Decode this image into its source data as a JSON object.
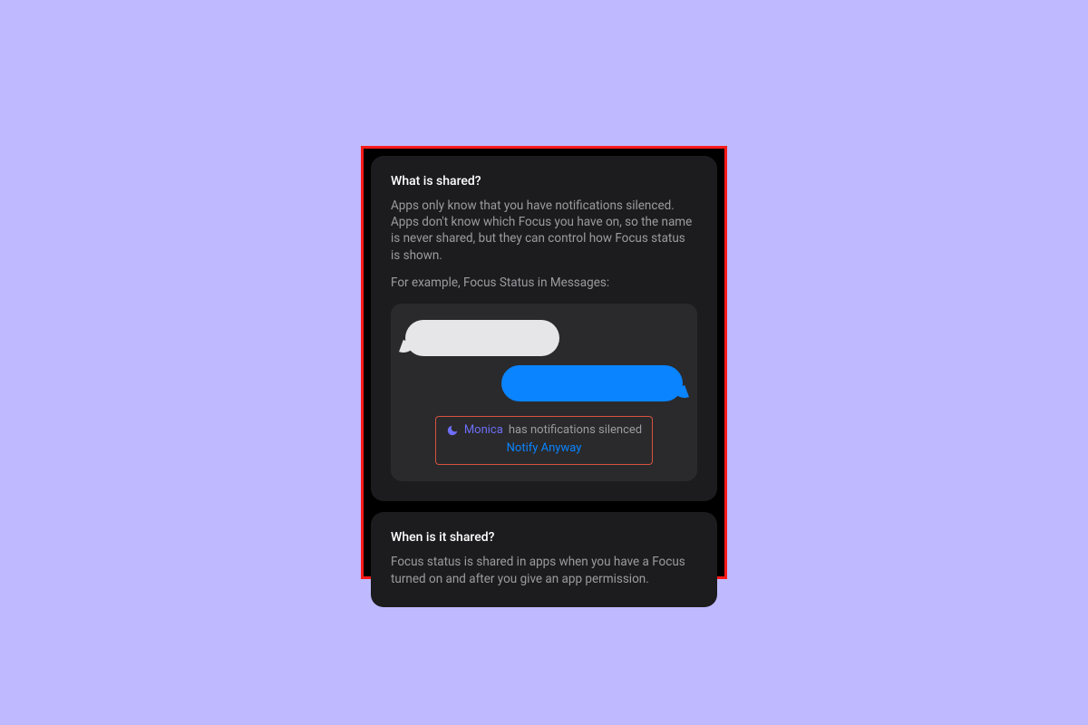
{
  "card1": {
    "title": "What is shared?",
    "para1": "Apps only know that you have notifications silenced. Apps don't know which Focus you have on, so the name is never shared, but they can control how Focus status is shown.",
    "para2": "For example, Focus Status in Messages:",
    "status": {
      "name": "Monica",
      "suffix": "has notifications silenced",
      "action": "Notify Anyway"
    }
  },
  "card2": {
    "title": "When is it shared?",
    "para1": "Focus status is shared in apps when you have a Focus turned on and after you give an app permission."
  }
}
